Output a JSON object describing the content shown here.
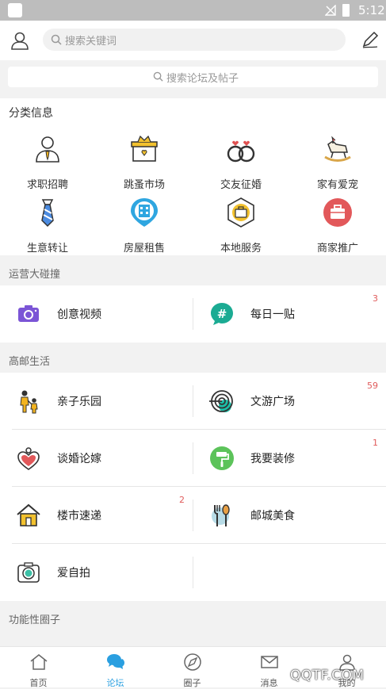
{
  "status": {
    "time": "5:12"
  },
  "header": {
    "search_placeholder": "搜索关键词"
  },
  "forum_search": {
    "placeholder": "搜索论坛及帖子"
  },
  "categories": {
    "title": "分类信息",
    "items": [
      {
        "label": "求职招聘",
        "icon": "job-person-icon"
      },
      {
        "label": "跳蚤市场",
        "icon": "market-box-icon"
      },
      {
        "label": "交友征婚",
        "icon": "rings-icon"
      },
      {
        "label": "家有爱宠",
        "icon": "rocking-horse-icon"
      },
      {
        "label": "生意转让",
        "icon": "tie-icon"
      },
      {
        "label": "房屋租售",
        "icon": "building-pin-icon"
      },
      {
        "label": "本地服务",
        "icon": "briefcase-hex-icon"
      },
      {
        "label": "商家推广",
        "icon": "shop-bag-icon"
      }
    ]
  },
  "groups": [
    {
      "title": "运营大碰撞",
      "items": [
        {
          "name": "创意视频",
          "badge": "",
          "icon": "camera-icon"
        },
        {
          "name": "每日一贴",
          "badge": "3",
          "icon": "hashtag-bubble-icon"
        }
      ]
    },
    {
      "title": "高邮生活",
      "items": [
        {
          "name": "亲子乐园",
          "badge": "",
          "icon": "parent-child-icon"
        },
        {
          "name": "文游广场",
          "badge": "59",
          "icon": "spiral-icon"
        },
        {
          "name": "谈婚论嫁",
          "badge": "",
          "icon": "heart-icon"
        },
        {
          "name": "我要装修",
          "badge": "1",
          "icon": "paint-roller-icon"
        },
        {
          "name": "楼市速递",
          "badge": "2",
          "icon": "house-icon"
        },
        {
          "name": "邮城美食",
          "badge": "",
          "icon": "fork-spoon-icon"
        },
        {
          "name": "爱自拍",
          "badge": "",
          "icon": "selfie-camera-icon"
        }
      ]
    },
    {
      "title": "功能性圈子",
      "items": []
    }
  ],
  "tabs": [
    {
      "label": "首页",
      "icon": "home-icon",
      "active": false
    },
    {
      "label": "论坛",
      "icon": "chat-bubbles-icon",
      "active": true
    },
    {
      "label": "圈子",
      "icon": "compass-icon",
      "active": false
    },
    {
      "label": "消息",
      "icon": "mail-icon",
      "active": false
    },
    {
      "label": "我的",
      "icon": "user-icon",
      "active": false
    }
  ],
  "watermark": "QQTF.COM",
  "colors": {
    "accent": "#2a9fe0",
    "badge": "#e05c5c",
    "purple": "#7b55d6",
    "teal": "#1bab93",
    "green": "#5cc35a"
  }
}
